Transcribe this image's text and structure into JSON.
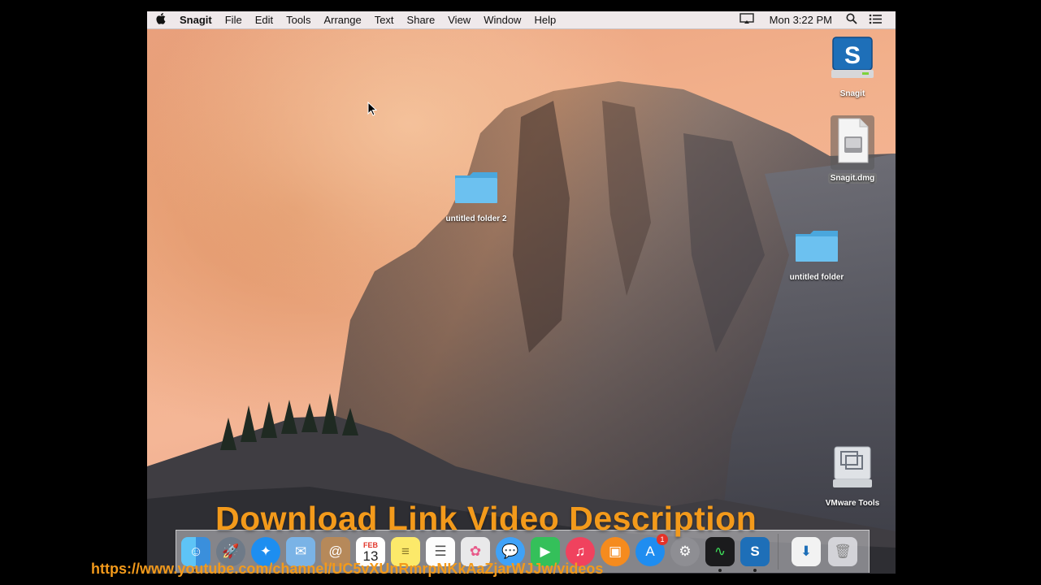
{
  "menubar": {
    "app_name": "Snagit",
    "menus": [
      "File",
      "Edit",
      "Tools",
      "Arrange",
      "Text",
      "Share",
      "View",
      "Window",
      "Help"
    ],
    "clock": "Mon 3:22 PM",
    "status_icons": [
      "airplay-display-icon",
      "spotlight-search-icon",
      "notification-center-icon"
    ]
  },
  "desktop": {
    "icons": [
      {
        "label": "Snagit",
        "icon": "snagit-drive-icon"
      },
      {
        "label": "Snagit.dmg",
        "icon": "disk-image-icon",
        "selected": true
      },
      {
        "label": "untitled folder 2",
        "icon": "folder-icon"
      },
      {
        "label": "untitled folder",
        "icon": "folder-icon"
      },
      {
        "label": "VMware Tools",
        "icon": "vmware-tools-drive-icon"
      }
    ]
  },
  "dock": {
    "apps": [
      "Finder",
      "Launchpad",
      "Safari",
      "Mail",
      "Contacts",
      "Calendar",
      "Notes",
      "Reminders",
      "Photos",
      "Messages",
      "FaceTime",
      "iTunes",
      "iBooks",
      "App Store",
      "System Preferences",
      "Activity Monitor",
      "Snagit",
      "Downloads",
      "Trash"
    ],
    "calendar_month": "FEB",
    "calendar_day": "13",
    "app_store_badge": "1"
  },
  "overlay": {
    "title": "Download Link Video Description",
    "url": "https://www.youtube.com/channel/UC5vXUnRmrpNKkAaZjarWJJw/videos"
  },
  "colors": {
    "overlay_text": "#f39a1b",
    "folder_blue": "#62b9ec"
  }
}
